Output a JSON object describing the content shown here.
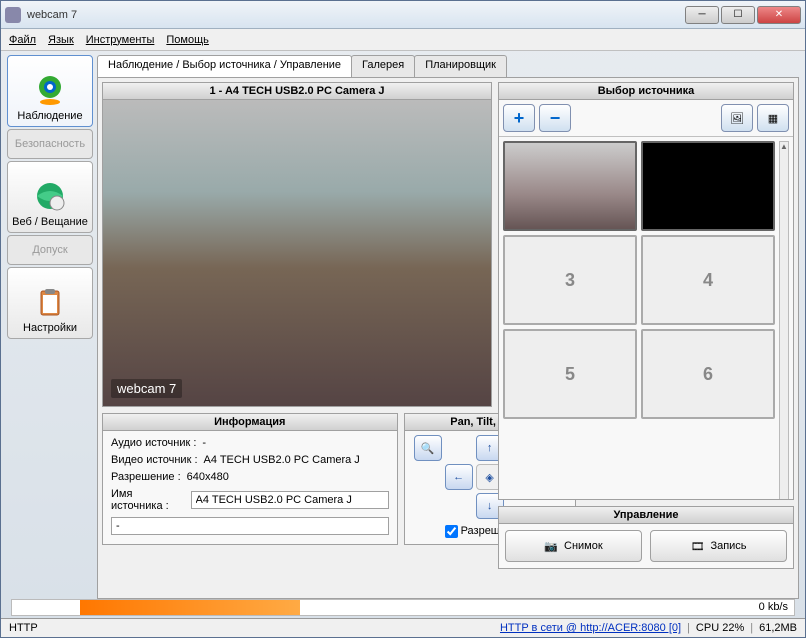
{
  "window": {
    "title": "webcam 7"
  },
  "menu": {
    "file": "Файл",
    "language": "Язык",
    "tools": "Инструменты",
    "help": "Помощь"
  },
  "nav": {
    "monitoring": "Наблюдение",
    "security": "Безопасность",
    "web": "Веб / Вещание",
    "access": "Допуск",
    "settings": "Настройки"
  },
  "tabs": {
    "main": "Наблюдение / Выбор источника / Управление",
    "gallery": "Галерея",
    "scheduler": "Планировщик"
  },
  "video": {
    "title": "1 - A4 TECH USB2.0 PC Camera J",
    "watermark": "webcam 7"
  },
  "info": {
    "header": "Информация",
    "audio_label": "Аудио источник :",
    "audio_value": "-",
    "video_label": "Видео источник :",
    "video_value": "A4 TECH USB2.0 PC Camera J",
    "res_label": "Разрешение :",
    "res_value": "640x480",
    "name_label": "Имя источника :",
    "name_value": "A4 TECH USB2.0 PC Camera J",
    "extra": "-"
  },
  "ptz": {
    "header": "Pan, Tilt, Zoom",
    "enabled_label": "Разрешено"
  },
  "source_select": {
    "header": "Выбор источника",
    "slot3": "3",
    "slot4": "4",
    "slot5": "5",
    "slot6": "6"
  },
  "controls": {
    "header": "Управление",
    "snapshot": "Снимок",
    "record": "Запись"
  },
  "bandwidth": {
    "rate": "0 kb/s"
  },
  "status": {
    "http": "HTTP",
    "link": "HTTP в сети @ http://ACER:8080 [0]",
    "cpu": "CPU 22%",
    "mem": "61,2MB"
  }
}
